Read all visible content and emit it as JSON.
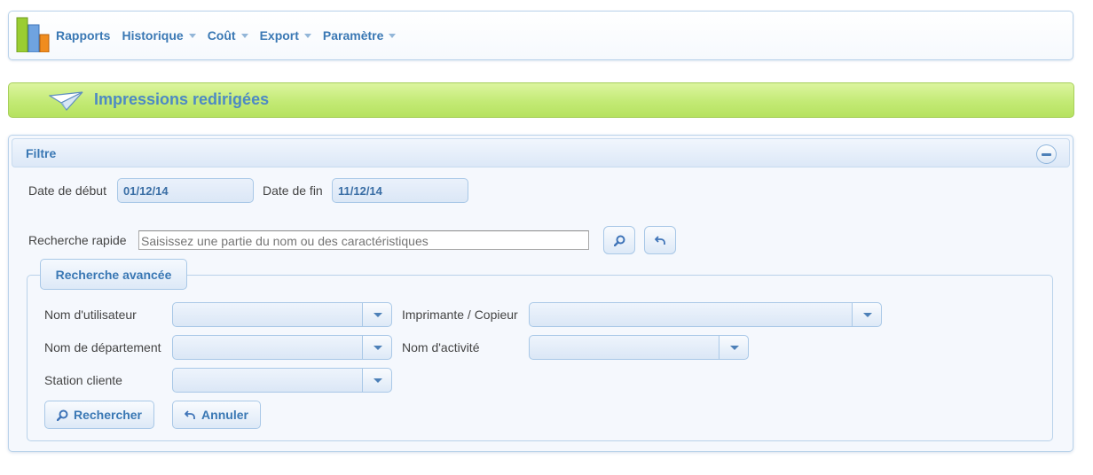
{
  "menu": {
    "items": [
      {
        "label": "Rapports",
        "has_dropdown": false
      },
      {
        "label": "Historique",
        "has_dropdown": true
      },
      {
        "label": "Coût",
        "has_dropdown": true
      },
      {
        "label": "Export",
        "has_dropdown": true
      },
      {
        "label": "Paramètre",
        "has_dropdown": true
      }
    ]
  },
  "page": {
    "title": "Impressions redirigées",
    "icon": "paper-plane-icon"
  },
  "filter": {
    "title": "Filtre",
    "start_date_label": "Date de début",
    "start_date_value": "01/12/14",
    "end_date_label": "Date de fin",
    "end_date_value": "11/12/14",
    "quick_search_label": "Recherche rapide",
    "quick_search_placeholder": "Saisissez une partie du nom ou des caractéristiques",
    "quick_search_value": ""
  },
  "advanced": {
    "title": "Recherche avancée",
    "user_label": "Nom d'utilisateur",
    "printer_label": "Imprimante / Copieur",
    "department_label": "Nom de département",
    "activity_label": "Nom d'activité",
    "client_label": "Station cliente",
    "search_button": "Rechercher",
    "cancel_button": "Annuler"
  },
  "colors": {
    "accent": "#3a78b4",
    "title_bar": "#c3ea75",
    "panel_border": "#b9d2ea"
  }
}
